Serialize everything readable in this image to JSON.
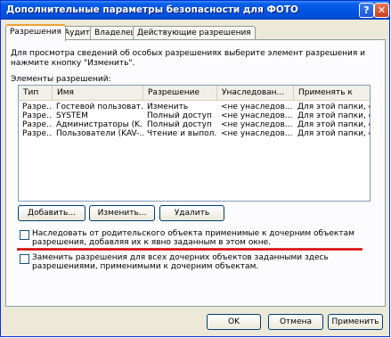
{
  "window": {
    "title": "Дополнительные параметры безопасности для ФОТО",
    "help_glyph": "?",
    "close_glyph": "✕"
  },
  "tabs": [
    {
      "label": "Разрешения",
      "active": true
    },
    {
      "label": "Аудит",
      "active": false
    },
    {
      "label": "Владелец",
      "active": false
    },
    {
      "label": "Действующие разрешения",
      "active": false
    }
  ],
  "permissions": {
    "description": "Для просмотра сведений об особых разрешениях выберите элемент разрешения и нажмите кнопку \"Изменить\".",
    "list_label": "Элементы разрешений:",
    "columns": [
      "Тип",
      "Имя",
      "Разрешение",
      "Унаследован...",
      "Применять к"
    ],
    "rows": [
      [
        "Разре...",
        "Гостевой пользоват...",
        "Изменить",
        "<не унаследов...",
        "Для этой папки, ее ..."
      ],
      [
        "Разре...",
        "SYSTEM",
        "Полный доступ",
        "<не унаследов...",
        "Для этой папки, ее ..."
      ],
      [
        "Разре...",
        "Администраторы (K...",
        "Полный доступ",
        "<не унаследов...",
        "Для этой папки, ее ..."
      ],
      [
        "Разре...",
        "Пользователи (KAV-...",
        "Чтение и выпол...",
        "<не унаследов...",
        "Для этой папки, ее ..."
      ]
    ],
    "buttons": {
      "add": "Добавить...",
      "edit": "Изменить...",
      "remove": "Удалить"
    },
    "inherit_checkbox": {
      "label": "Наследовать от родительского объекта применимые к дочерним объектам разрешения, добавляя их к явно заданным в этом окне.",
      "checked": false
    },
    "replace_checkbox": {
      "label": "Заменить разрешения для всех дочерних объектов заданными здесь разрешениями, применимыми к дочерним объектам.",
      "checked": false
    }
  },
  "footer": {
    "ok": "OK",
    "cancel": "Отмена",
    "apply": "Применить"
  },
  "colors": {
    "annotation_line": "#d40000",
    "title_bar": "#0054e3",
    "tab_highlight": "#f0a030"
  }
}
